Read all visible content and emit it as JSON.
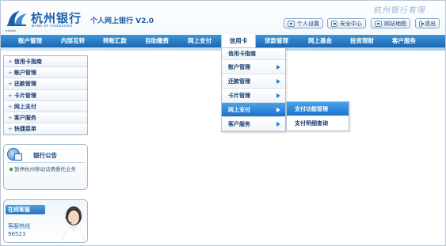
{
  "header": {
    "bank_name_cn": "杭州银行",
    "bank_name_en": "BANK OF HANGZHOU",
    "logo_sub": "hzbank",
    "product_title": "个人网上银行 V2.0",
    "slogan": "杭州银行有限",
    "buttons": [
      {
        "label": "个人设置",
        "icon": "settings-icon"
      },
      {
        "label": "安全中心",
        "icon": "shield-icon"
      },
      {
        "label": "网站地图",
        "icon": "map-icon"
      },
      {
        "label": "退出",
        "icon": "logout-icon"
      }
    ]
  },
  "nav": {
    "items": [
      {
        "label": "账户管理"
      },
      {
        "label": "内部互转"
      },
      {
        "label": "转账汇款"
      },
      {
        "label": "自助缴费"
      },
      {
        "label": "网上支付"
      },
      {
        "label": "信用卡"
      },
      {
        "label": "贷款管理"
      },
      {
        "label": "网上基金"
      },
      {
        "label": "投资理财"
      },
      {
        "label": "客户服务"
      }
    ],
    "active": "信用卡"
  },
  "sidebar": {
    "items": [
      {
        "label": "信用卡指南"
      },
      {
        "label": "账户管理"
      },
      {
        "label": "还款管理"
      },
      {
        "label": "卡片管理"
      },
      {
        "label": "网上支付"
      },
      {
        "label": "客户服务"
      },
      {
        "label": "快捷菜单"
      }
    ],
    "notice": {
      "title": "银行公告",
      "text": "暂停杭州移动话费委托业务"
    },
    "service": {
      "tag": "在线客服",
      "line1": "客服热线",
      "line2": "96523"
    }
  },
  "dropdown": {
    "items": [
      {
        "label": "信用卡指南",
        "has_sub": false
      },
      {
        "label": "账户管理",
        "has_sub": true
      },
      {
        "label": "还款管理",
        "has_sub": true
      },
      {
        "label": "卡片管理",
        "has_sub": true
      },
      {
        "label": "网上支付",
        "has_sub": true
      },
      {
        "label": "客户服务",
        "has_sub": true
      }
    ],
    "active": "网上支付",
    "submenu": [
      {
        "label": "支付功能管理"
      },
      {
        "label": "支付明细查询"
      }
    ],
    "submenu_active": "支付功能管理"
  },
  "colors": {
    "brand_blue": "#1d5fa8",
    "nav_blue": "#1c66b3",
    "highlight": "#2e7fd0"
  }
}
